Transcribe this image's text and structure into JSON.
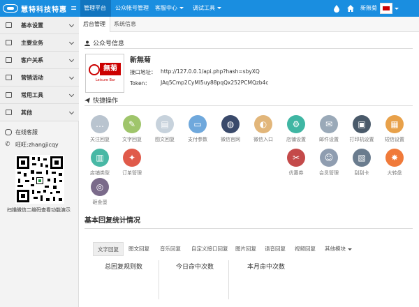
{
  "brand": {
    "name": "慧特科技特惠"
  },
  "topnav": {
    "items": [
      {
        "label": "管理平台",
        "dropdown": false
      },
      {
        "label": "公众帐号管理",
        "dropdown": false
      },
      {
        "label": "客服中心",
        "dropdown": true
      },
      {
        "label": "调试工具",
        "dropdown": true
      }
    ],
    "user": "新無菊"
  },
  "sidebar": {
    "items": [
      {
        "label": "基本设置"
      },
      {
        "label": "主要业务"
      },
      {
        "label": "客户关系"
      },
      {
        "label": "营销活动"
      },
      {
        "label": "常用工具"
      },
      {
        "label": "其他"
      }
    ],
    "support": {
      "online_service": "在线客服",
      "wangwang": "旺旺:zhangjicqy",
      "qr_caption": "扫描微信二维码查看功能演示"
    }
  },
  "tabs": [
    {
      "label": "后台管理"
    },
    {
      "label": "系统信息"
    }
  ],
  "account": {
    "section_title": "公众号信息",
    "name": "新無菊",
    "logo_text": "無菊",
    "logo_sub": "Leisure Bar",
    "api_label": "接口地址：",
    "api_value": "http://127.0.0.1/api.php?hash=sbyXQ",
    "token_label": "Token：",
    "token_value": "JAq5Cmp2CyMI5uy88pqQx252PCMQzb4c"
  },
  "quick_ops": {
    "section_title": "快捷操作",
    "items": [
      {
        "label": "关注回复",
        "icon": "chat-icon",
        "color": "#b9c4cf",
        "glyph": "…"
      },
      {
        "label": "文字回复",
        "icon": "edit-icon",
        "color": "#9fc56b",
        "glyph": "✎"
      },
      {
        "label": "图文回复",
        "icon": "news-icon",
        "color": "#c7d2dc",
        "glyph": "▤"
      },
      {
        "label": "支付参数",
        "icon": "card-icon",
        "color": "#6fa8dc",
        "glyph": "▭"
      },
      {
        "label": "微信官网",
        "icon": "globe-icon",
        "color": "#3a4a6b",
        "glyph": "◍"
      },
      {
        "label": "微信入口",
        "icon": "palette-icon",
        "color": "#e2b67a",
        "glyph": "◐"
      },
      {
        "label": "店铺设置",
        "icon": "gear-icon",
        "color": "#3fb6a3",
        "glyph": "⚙"
      },
      {
        "label": "邮件设置",
        "icon": "mail-icon",
        "color": "#9aa9b8",
        "glyph": "✉"
      },
      {
        "label": "打印机设置",
        "icon": "printer-icon",
        "color": "#4a5a6a",
        "glyph": "▣"
      },
      {
        "label": "短信设置",
        "icon": "clipboard-icon",
        "color": "#e8a14a",
        "glyph": "▦"
      },
      {
        "label": "店铺类型",
        "icon": "chart-icon",
        "color": "#48b8a5",
        "glyph": "▥"
      },
      {
        "label": "订单管理",
        "icon": "cart-icon",
        "color": "#e05a4a",
        "glyph": "✦"
      },
      {
        "label": "优惠券",
        "icon": "coupon-icon",
        "color": "#c44a4a",
        "glyph": "✂"
      },
      {
        "label": "会员管理",
        "icon": "member-icon",
        "color": "#8f9db0",
        "glyph": "☺"
      },
      {
        "label": "刮刮卡",
        "icon": "scratch-icon",
        "color": "#6a7c8e",
        "glyph": "▧"
      },
      {
        "label": "大转盘",
        "icon": "wheel-icon",
        "color": "#f07a3a",
        "glyph": "✸"
      },
      {
        "label": "砸金蛋",
        "icon": "egg-icon",
        "color": "#7a6a8a",
        "glyph": "◎"
      }
    ]
  },
  "stats": {
    "title": "基本回复统计情况",
    "tabs": [
      {
        "label": "文字回复",
        "active": true
      },
      {
        "label": "图文回复",
        "active": false
      },
      {
        "label": "音乐回复",
        "active": false
      },
      {
        "label": "自定义接口回复",
        "active": false
      },
      {
        "label": "图片回复",
        "active": false
      },
      {
        "label": "语音回复",
        "active": false
      },
      {
        "label": "视频回复",
        "active": false
      },
      {
        "label": "其他模块",
        "active": false,
        "dropdown": true
      }
    ],
    "columns": [
      "总回复规则数",
      "今日命中次数",
      "本月命中次数"
    ]
  }
}
